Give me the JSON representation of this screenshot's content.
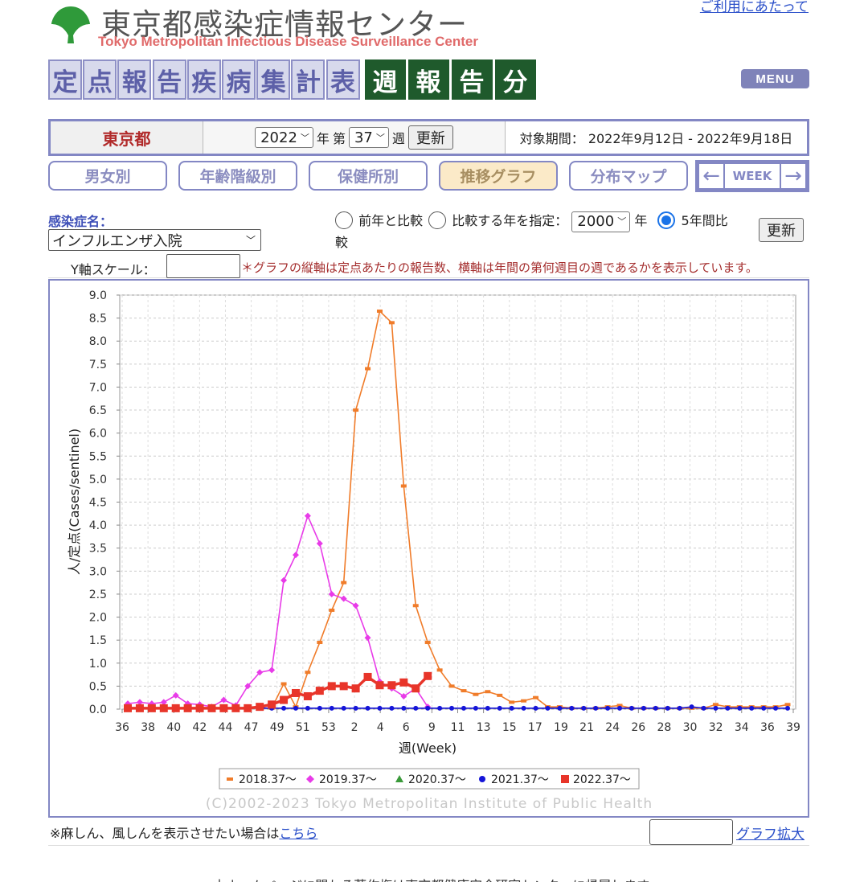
{
  "header": {
    "title": "東京都感染症情報センター",
    "subtitle": "Tokyo Metropolitan Infectious Disease Surveillance Center",
    "link": "ご利用にあたって",
    "banner_light": [
      "定",
      "点",
      "報",
      "告",
      "疾",
      "病",
      "集",
      "計",
      "表"
    ],
    "banner_dark": [
      "週",
      "報",
      "告",
      "分"
    ],
    "menu": "MENU"
  },
  "controls": {
    "prefecture": "東京都",
    "year": "2022",
    "year_suffix": "年",
    "week_prefix": "第",
    "week": "37",
    "week_suffix": "週",
    "update": "更新",
    "period_label": "対象期間：",
    "period_value": "2022年9月12日 - 2022年9月18日"
  },
  "tabs": [
    "男女別",
    "年齢階級別",
    "保健所別",
    "推移グラフ",
    "分布マップ"
  ],
  "week_nav": {
    "prev": "←",
    "label": "WEEK",
    "next": "→"
  },
  "disease": {
    "label": "感染症名：",
    "selected": "インフルエンザ入院"
  },
  "compare": {
    "opt1": "前年と比較",
    "opt2": "比較する年を指定：",
    "year": "2000",
    "year_suffix": "年",
    "opt3": "5年間比",
    "opt3_wrap": "較",
    "update": "更新"
  },
  "yaxis": {
    "label": "Y軸スケール：",
    "note": "＊グラフの縦軸は定点あたりの報告数、横軸は年間の第何週目の週であるかを表示しています。"
  },
  "chart_data": {
    "type": "line",
    "xlabel": "週(Week)",
    "ylabel": "人/定点(Cases/sentinel)",
    "ylim": [
      0,
      9.0
    ],
    "ytick_values": [
      0.0,
      0.5,
      1.0,
      1.5,
      2.0,
      2.5,
      3.0,
      3.5,
      4.0,
      4.5,
      5.0,
      5.5,
      6.0,
      6.5,
      7.0,
      7.5,
      8.0,
      8.5,
      9.0
    ],
    "xtick_labels": [
      "36",
      "38",
      "40",
      "42",
      "44",
      "47",
      "49",
      "51",
      "53",
      "2",
      "4",
      "6",
      "9",
      "11",
      "13",
      "15",
      "17",
      "19",
      "21",
      "24",
      "26",
      "28",
      "30",
      "32",
      "34",
      "36",
      "39"
    ],
    "copyright": "(C)2002-2023 Tokyo Metropolitan Institute of Public Health",
    "series": [
      {
        "name": "2018.37～",
        "color": "#f07c2a",
        "marker": "square-small",
        "values": [
          0.02,
          0.02,
          0.02,
          0.02,
          0.02,
          0.02,
          0.02,
          0.02,
          0.02,
          0.02,
          0.02,
          0.02,
          0.02,
          0.55,
          0.05,
          0.8,
          1.45,
          2.15,
          2.75,
          6.5,
          7.4,
          8.65,
          8.4,
          4.85,
          2.25,
          1.45,
          0.85,
          0.5,
          0.4,
          0.32,
          0.38,
          0.3,
          0.15,
          0.18,
          0.25,
          0.05,
          0.05,
          0.02,
          0.02,
          0.02,
          0.05,
          0.08,
          0.02,
          0.02,
          0.02,
          0.02,
          0.02,
          0.02,
          0.02,
          0.1,
          0.05,
          0.05,
          0.05,
          0.05,
          0.05,
          0.1
        ]
      },
      {
        "name": "2019.37～",
        "color": "#e83be8",
        "marker": "diamond",
        "values": [
          0.12,
          0.15,
          0.12,
          0.15,
          0.3,
          0.12,
          0.1,
          0.05,
          0.2,
          0.08,
          0.5,
          0.8,
          0.85,
          2.8,
          3.35,
          4.2,
          3.6,
          2.5,
          2.4,
          2.25,
          1.55,
          0.6,
          0.45,
          0.28,
          0.45,
          0.05
        ]
      },
      {
        "name": "2020.37～",
        "color": "#3a9a3a",
        "marker": "triangle",
        "values": []
      },
      {
        "name": "2021.37～",
        "color": "#1515d8",
        "marker": "circle",
        "values": [
          0.02,
          0.02,
          0.02,
          0.02,
          0.02,
          0.02,
          0.02,
          0.02,
          0.02,
          0.02,
          0.02,
          0.02,
          0.02,
          0.02,
          0.02,
          0.02,
          0.02,
          0.02,
          0.02,
          0.02,
          0.02,
          0.02,
          0.02,
          0.02,
          0.02,
          0.02,
          0.02,
          0.02,
          0.02,
          0.02,
          0.02,
          0.02,
          0.02,
          0.02,
          0.02,
          0.02,
          0.02,
          0.02,
          0.02,
          0.02,
          0.02,
          0.02,
          0.02,
          0.02,
          0.02,
          0.02,
          0.02,
          0.05,
          0.02,
          0.02,
          0.02,
          0.02,
          0.02,
          0.02,
          0.02,
          0.02
        ]
      },
      {
        "name": "2022.37～",
        "color": "#e8352a",
        "marker": "square",
        "values": [
          0.02,
          0.02,
          0.02,
          0.02,
          0.02,
          0.02,
          0.02,
          0.02,
          0.02,
          0.02,
          0.02,
          0.05,
          0.1,
          0.2,
          0.35,
          0.28,
          0.4,
          0.5,
          0.5,
          0.45,
          0.7,
          0.52,
          0.52,
          0.58,
          0.45,
          0.72
        ]
      }
    ]
  },
  "footer": {
    "text": "※麻しん、風しんを表示させたい場合は",
    "link": "こちら",
    "zoom_link": "グラフ拡大",
    "bottom": "本ホームページに関わる著作権は東京都健康安全研究センターに帰属します。"
  }
}
